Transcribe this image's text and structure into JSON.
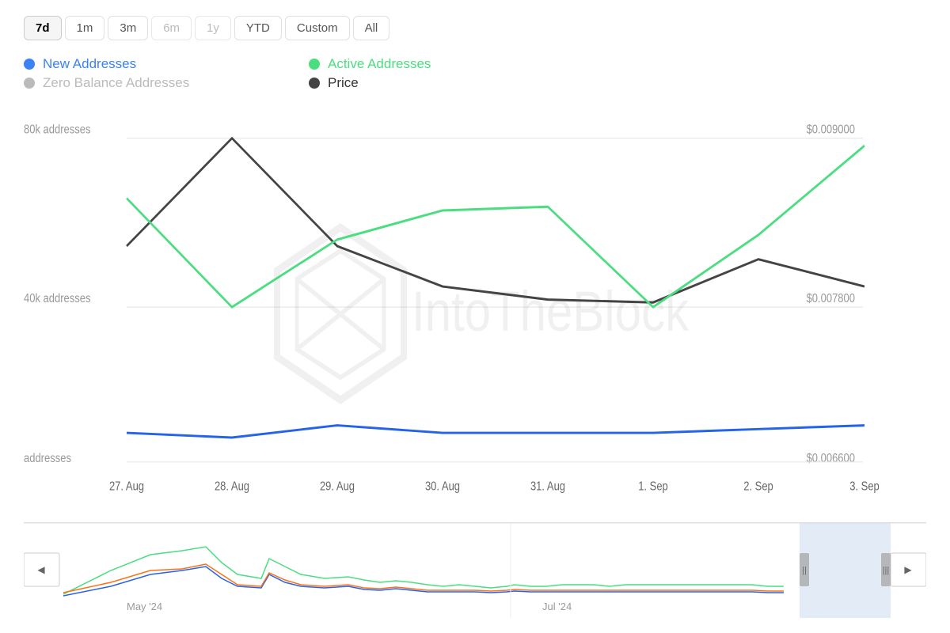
{
  "timeRange": {
    "buttons": [
      {
        "label": "7d",
        "active": true,
        "disabled": false
      },
      {
        "label": "1m",
        "active": false,
        "disabled": false
      },
      {
        "label": "3m",
        "active": false,
        "disabled": false
      },
      {
        "label": "6m",
        "active": false,
        "disabled": true
      },
      {
        "label": "1y",
        "active": false,
        "disabled": true
      },
      {
        "label": "YTD",
        "active": false,
        "disabled": false
      },
      {
        "label": "Custom",
        "active": false,
        "disabled": false
      },
      {
        "label": "All",
        "active": false,
        "disabled": false
      }
    ]
  },
  "legend": [
    {
      "label": "New Addresses",
      "color": "#3b82f6",
      "muted": false,
      "dotColor": "#3b82f6"
    },
    {
      "label": "Active Addresses",
      "color": "#4ade80",
      "muted": false,
      "dotColor": "#4ade80"
    },
    {
      "label": "Zero Balance Addresses",
      "color": "#bbb",
      "muted": true,
      "dotColor": "#bbb"
    },
    {
      "label": "Price",
      "color": "#333",
      "muted": false,
      "dotColor": "#444"
    }
  ],
  "chart": {
    "yAxisLeft": [
      "80k addresses",
      "40k addresses",
      "addresses"
    ],
    "yAxisRight": [
      "$0.009000",
      "$0.007800",
      "$0.006600"
    ],
    "xAxis": [
      "27. Aug",
      "28. Aug",
      "29. Aug",
      "30. Aug",
      "31. Aug",
      "1. Sep",
      "2. Sep",
      "3. Sep"
    ],
    "watermark": "IntoTheBlock"
  },
  "navigator": {
    "labels": [
      "May '24",
      "Jul '24"
    ],
    "leftArrow": "◀",
    "rightArrow": "▶"
  }
}
